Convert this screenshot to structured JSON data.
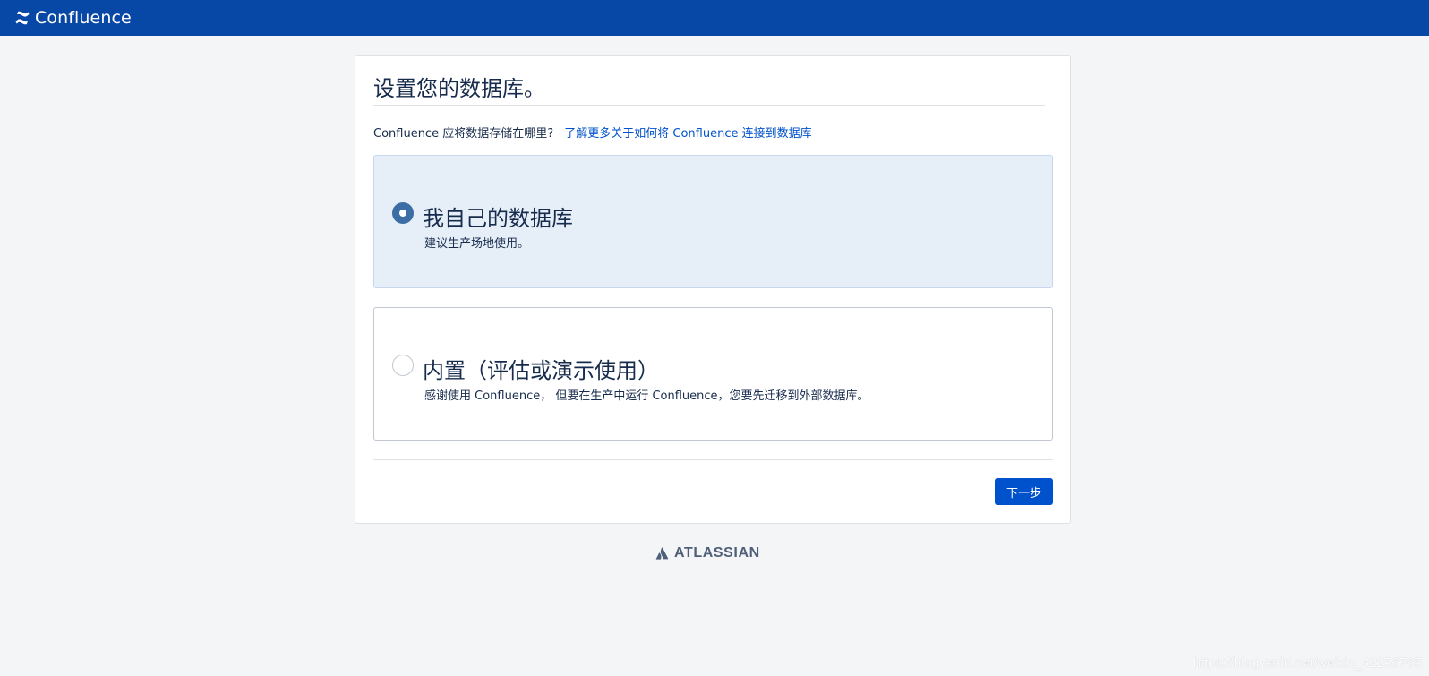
{
  "header": {
    "logo_text": "Confluence",
    "logo_icon": "confluence-icon",
    "bg_color": "#0747a6"
  },
  "setup": {
    "title": "设置您的数据库。",
    "question": "Confluence 应将数据存储在哪里?",
    "help_link": "了解更多关于如何将 Confluence 连接到数据库",
    "options": [
      {
        "title": "我自己的数据库",
        "description": "建议生产场地使用。",
        "selected": true
      },
      {
        "title": "内置（评估或演示使用）",
        "description": "感谢使用 Confluence， 但要在生产中运行 Confluence，您要先迁移到外部数据库。",
        "selected": false
      }
    ],
    "next_button": "下一步"
  },
  "footer": {
    "logo_text": "ATLASSIAN",
    "logo_icon": "atlassian-icon"
  },
  "watermark": "https://blog.csdn.net/weixin_42256765",
  "colors": {
    "accent": "#0052cc",
    "selected_bg": "#e6eef8",
    "radio_selected": "#3c6ea5"
  }
}
